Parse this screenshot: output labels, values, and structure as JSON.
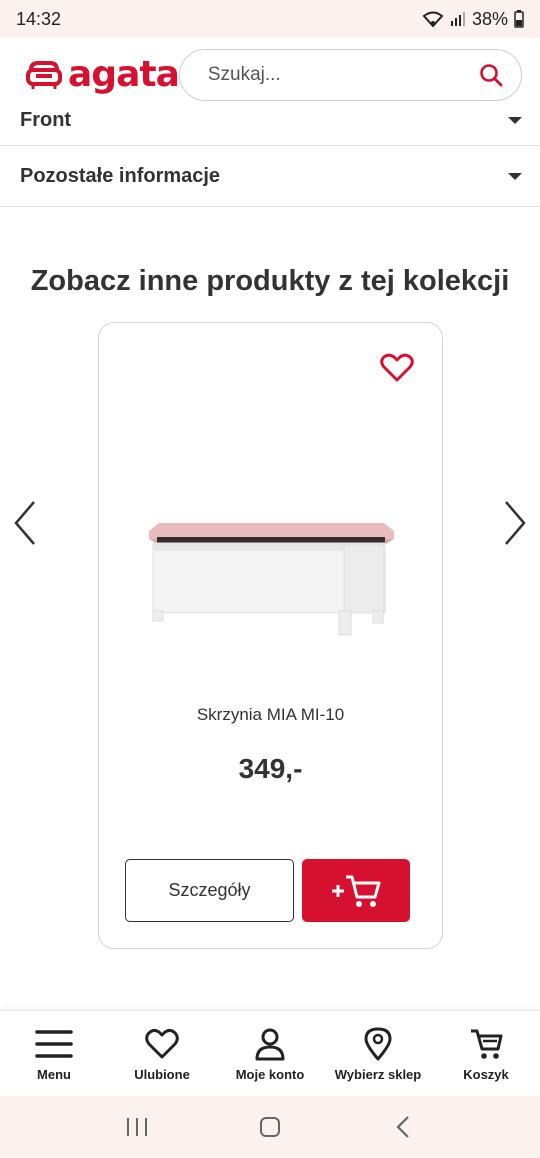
{
  "status_bar": {
    "time": "14:32",
    "battery": "38%"
  },
  "header": {
    "logo_text": "agata",
    "search_placeholder": "Szukaj...",
    "icons": [
      "sofa-logo-icon",
      "search-icon"
    ]
  },
  "accordion": [
    {
      "label": "Front"
    },
    {
      "label": "Pozostałe informacje"
    }
  ],
  "section_title": "Zobacz inne produkty z tej kolekcji",
  "product": {
    "name": "Skrzynia MIA MI-10",
    "price": "349,-",
    "details_label": "Szczegóły",
    "favorite_icon": "heart-icon",
    "cart_icon": "add-to-cart-icon"
  },
  "bottom_nav": [
    {
      "label": "Menu",
      "icon": "hamburger-menu-icon"
    },
    {
      "label": "Ulubione",
      "icon": "heart-icon"
    },
    {
      "label": "Moje konto",
      "icon": "user-icon"
    },
    {
      "label": "Wybierz sklep",
      "icon": "location-pin-icon"
    },
    {
      "label": "Koszyk",
      "icon": "shopping-cart-icon"
    }
  ],
  "colors": {
    "brand": "#d6112f",
    "text": "#333333",
    "system_bar": "#fbf1ee"
  }
}
